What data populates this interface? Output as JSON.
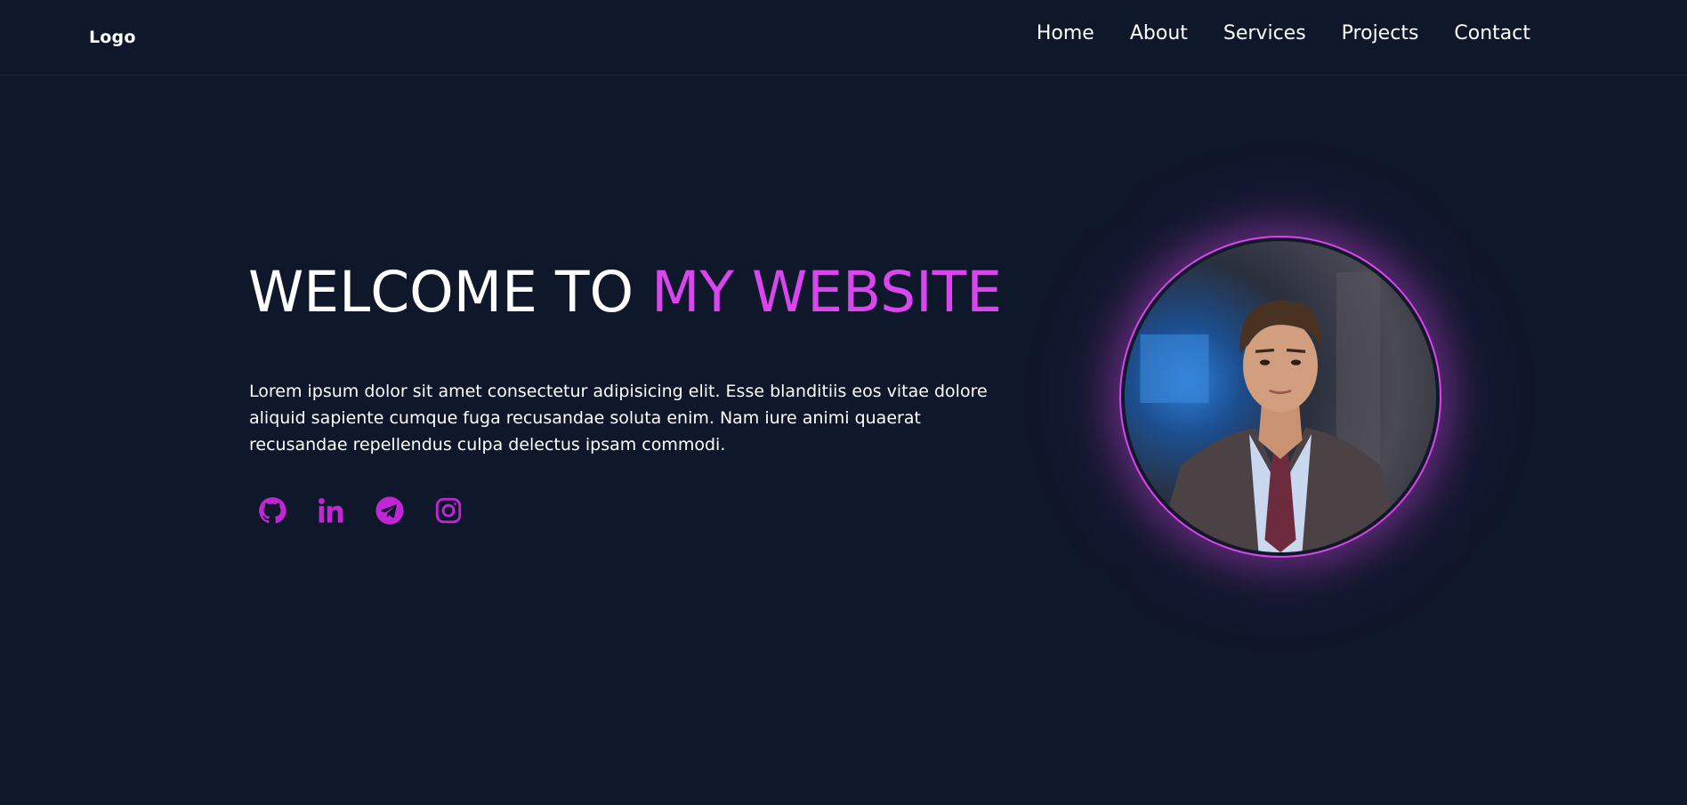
{
  "nav": {
    "logo": "Logo",
    "links": [
      {
        "label": "Home"
      },
      {
        "label": "About"
      },
      {
        "label": "Services"
      },
      {
        "label": "Projects"
      },
      {
        "label": "Contact"
      }
    ]
  },
  "hero": {
    "title_prefix": "WELCOME TO",
    "title_accent": "MY WEBSITE",
    "description": "Lorem ipsum dolor sit amet consectetur adipisicing elit. Esse blanditiis eos vitae dolore aliquid sapiente cumque fuga recusandae soluta enim. Nam iure animi quaerat recusandae repellendus culpa delectus ipsam commodi.",
    "socials": [
      {
        "icon": "github-icon"
      },
      {
        "icon": "linkedin-icon"
      },
      {
        "icon": "telegram-icon"
      },
      {
        "icon": "instagram-icon"
      }
    ]
  },
  "colors": {
    "background": "#0f172a",
    "accent": "#d946ef",
    "text": "#ffffff"
  }
}
